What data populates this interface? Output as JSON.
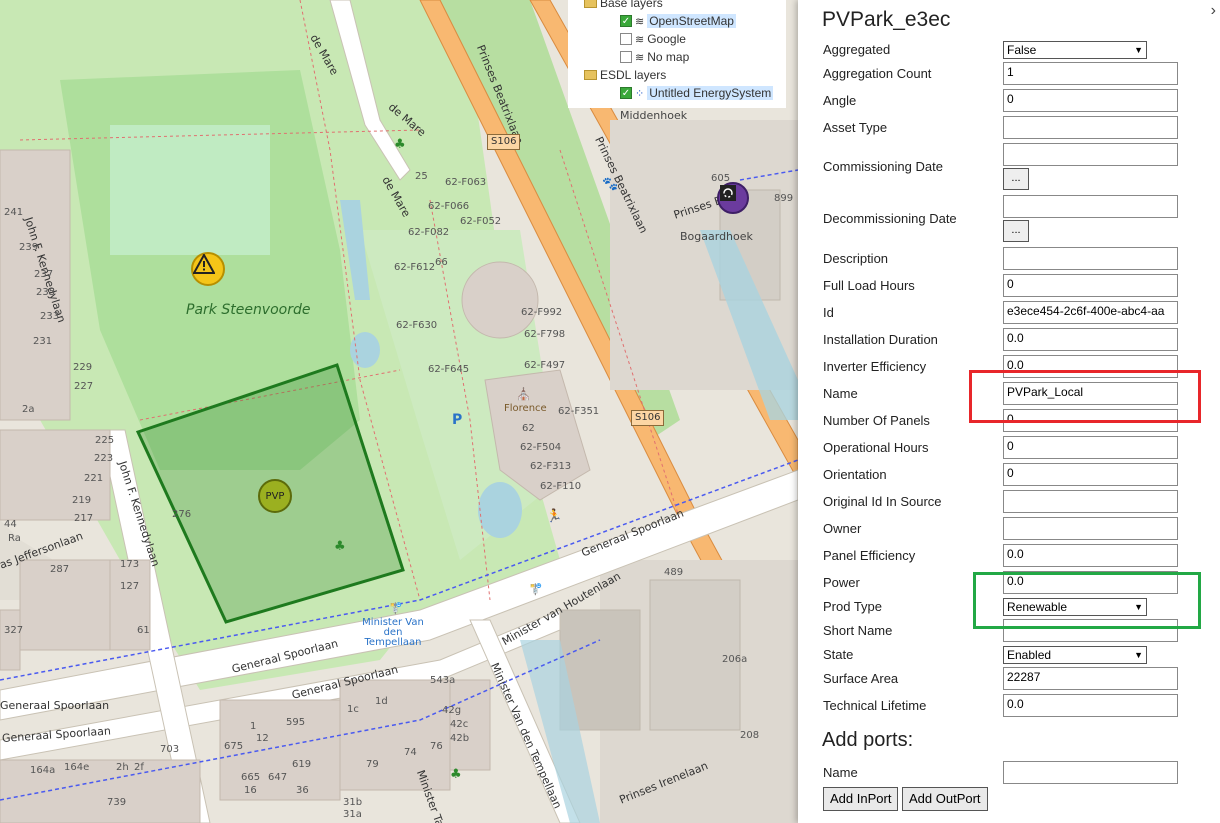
{
  "layer_tree": {
    "base_layers_label": "Base layers",
    "items": [
      {
        "label": "OpenStreetMap",
        "checked": true,
        "selected": true
      },
      {
        "label": "Google",
        "checked": false,
        "selected": false
      },
      {
        "label": "No map",
        "checked": false,
        "selected": false
      }
    ],
    "esdl_layers_label": "ESDL layers",
    "esdl_item": {
      "label": "Untitled EnergySystem",
      "checked": true,
      "selected": true
    }
  },
  "map": {
    "park_name": "Park Steenvoorde",
    "pvp_marker": "PVP",
    "florence_label": "Florence",
    "parking": "P",
    "shields": [
      "S106",
      "S106"
    ],
    "streets": [
      "Prinses Beatrixlaan",
      "Prinses Beatrixlaan",
      "de Mare",
      "de Mare",
      "de Mare",
      "John F. Kennedylaan",
      "John F. Kennedylaan",
      "Generaal Spoorlaan",
      "Generaal Spoorlaan",
      "Generaal Spoorlaan",
      "Generaal Spoorlaan",
      "Generaal Spoorlaan",
      "Minister van Houtenlaan",
      "Minister Van den Tempellaan",
      "Minister Tal",
      "Prinses Irenelaan",
      "Prinses B",
      "as Jeffersonlaan"
    ],
    "places": [
      "Middenhoek",
      "Bogaardhoek",
      "Minister Van den Tempellaan"
    ],
    "house_numbers": [
      "62-F063",
      "62-F066",
      "62-F052",
      "62-F082",
      "62-F612",
      "62-F630",
      "62-F645",
      "62-F992",
      "62-F798",
      "62-F497",
      "62-F351",
      "62-F504",
      "62-F313",
      "62-F110",
      "62",
      "25",
      "66",
      "605",
      "899",
      "489",
      "206a",
      "208",
      "241",
      "239",
      "237",
      "235",
      "233",
      "231",
      "229",
      "227",
      "2a",
      "225",
      "223",
      "221",
      "219",
      "217",
      "276",
      "287",
      "173",
      "127",
      "61",
      "327",
      "44",
      "595",
      "675",
      "703",
      "665",
      "647",
      "619",
      "739",
      "543a",
      "1c",
      "1d",
      "42g",
      "42c",
      "42b",
      "74",
      "76",
      "79",
      "31b",
      "31a",
      "164a",
      "164e",
      "2h",
      "2f",
      "12",
      "16",
      "36",
      "Ra",
      "1"
    ]
  },
  "panel": {
    "title": "PVPark_e3ec",
    "fields": [
      {
        "label": "Aggregated",
        "type": "select",
        "value": "False"
      },
      {
        "label": "Aggregation Count",
        "type": "input",
        "value": "1"
      },
      {
        "label": "Angle",
        "type": "input",
        "value": "0"
      },
      {
        "label": "Asset Type",
        "type": "input",
        "value": ""
      },
      {
        "label": "Commissioning Date",
        "type": "date",
        "value": "",
        "button": "..."
      },
      {
        "label": "Decommissioning Date",
        "type": "date",
        "value": "",
        "button": "..."
      },
      {
        "label": "Description",
        "type": "input",
        "value": ""
      },
      {
        "label": "Full Load Hours",
        "type": "input",
        "value": "0"
      },
      {
        "label": "Id",
        "type": "input",
        "value": "e3ece454-2c6f-400e-abc4-aa"
      },
      {
        "label": "Installation Duration",
        "type": "input",
        "value": "0.0"
      },
      {
        "label": "Inverter Efficiency",
        "type": "input",
        "value": "0.0"
      },
      {
        "label": "Name",
        "type": "input",
        "value": "PVPark_Local"
      },
      {
        "label": "Number Of Panels",
        "type": "input",
        "value": "0"
      },
      {
        "label": "Operational Hours",
        "type": "input",
        "value": "0"
      },
      {
        "label": "Orientation",
        "type": "input",
        "value": "0"
      },
      {
        "label": "Original Id In Source",
        "type": "input",
        "value": ""
      },
      {
        "label": "Owner",
        "type": "input",
        "value": ""
      },
      {
        "label": "Panel Efficiency",
        "type": "input",
        "value": "0.0"
      },
      {
        "label": "Power",
        "type": "input",
        "value": "0.0"
      },
      {
        "label": "Prod Type",
        "type": "select",
        "value": "Renewable"
      },
      {
        "label": "Short Name",
        "type": "input",
        "value": ""
      },
      {
        "label": "State",
        "type": "select",
        "value": "Enabled"
      },
      {
        "label": "Surface Area",
        "type": "input",
        "value": "22287"
      },
      {
        "label": "Technical Lifetime",
        "type": "input",
        "value": "0.0"
      }
    ],
    "add_ports": {
      "title": "Add ports:",
      "name_label": "Name",
      "name_value": "",
      "add_inport": "Add InPort",
      "add_outport": "Add OutPort"
    },
    "close_glyph": "›"
  },
  "colors": {
    "highlight_red": "#e8262a",
    "highlight_green": "#22a845",
    "polygon": "#1e7a1e"
  }
}
